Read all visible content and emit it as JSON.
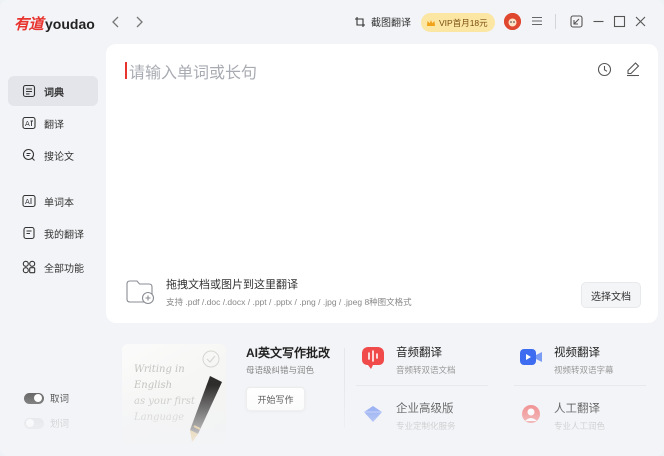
{
  "app": {
    "logo_cn": "有道",
    "logo_en": "youdao"
  },
  "toolbar": {
    "screenshot_label": "截图翻译",
    "vip_label": "VIP首月18元",
    "icons": [
      "back-arrow-icon",
      "forward-arrow-icon",
      "screenshot-icon",
      "crown-icon",
      "menu-icon",
      "mini-window-icon",
      "minimize-icon",
      "maximize-icon",
      "close-icon"
    ]
  },
  "sidebar": {
    "items": [
      {
        "label": "词典",
        "icon": "dictionary-icon",
        "active": true
      },
      {
        "label": "翻译",
        "icon": "translate-icon",
        "active": false
      },
      {
        "label": "搜论文",
        "icon": "paper-search-icon",
        "active": false
      },
      {
        "label": "单词本",
        "icon": "wordbook-icon",
        "active": false
      },
      {
        "label": "我的翻译",
        "icon": "my-translation-icon",
        "active": false
      },
      {
        "label": "全部功能",
        "icon": "all-features-icon",
        "active": false
      }
    ],
    "toggles": [
      {
        "label": "取词",
        "on": true
      },
      {
        "label": "划词",
        "on": false
      }
    ]
  },
  "search": {
    "placeholder": "请输入单词或长句",
    "value": ""
  },
  "upload": {
    "title": "拖拽文档或图片到这里翻译",
    "subtitle": "支持 .pdf /.doc /.docx / .ppt / .pptx / .png / .jpg / .jpeg 8种图文格式",
    "button": "选择文档"
  },
  "features": {
    "ai_writing": {
      "title": "AI英文写作批改",
      "subtitle": "母语级纠错与润色",
      "button": "开始写作",
      "card_script": [
        "Writing in",
        "English",
        "as your first",
        "Language"
      ]
    },
    "items": [
      {
        "title": "音频翻译",
        "subtitle": "音频转双语文档",
        "icon": "audio-translate-icon",
        "color": "#f04a4a"
      },
      {
        "title": "视频翻译",
        "subtitle": "视频转双语字幕",
        "icon": "video-translate-icon",
        "color": "#3d6cf0"
      },
      {
        "title": "企业高级版",
        "subtitle": "专业定制化服务",
        "icon": "enterprise-icon",
        "color": "#6c8ff2"
      },
      {
        "title": "人工翻译",
        "subtitle": "专业人工润色",
        "icon": "human-translate-icon",
        "color": "#f06a6a"
      }
    ]
  },
  "colors": {
    "brand_red": "#e8332e",
    "vip_bg": "#fbe6a4",
    "sidebar_active": "#e3e5ea"
  }
}
